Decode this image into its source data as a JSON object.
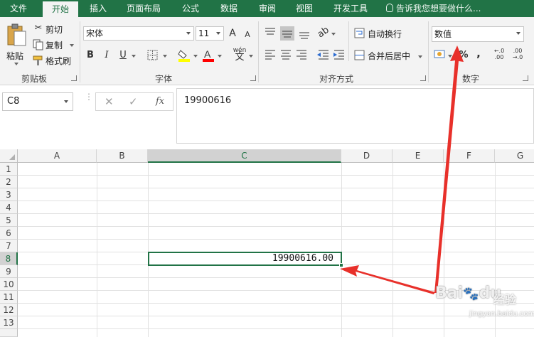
{
  "tabs": [
    "文件",
    "开始",
    "插入",
    "页面布局",
    "公式",
    "数据",
    "审阅",
    "视图",
    "开发工具"
  ],
  "tell_me": "告诉我您想要做什么...",
  "clipboard": {
    "paste": "粘贴",
    "cut": "剪切",
    "copy": "复制",
    "format_painter": "格式刷",
    "group": "剪贴板"
  },
  "font": {
    "name": "宋体",
    "size": "11",
    "bold": "B",
    "italic": "I",
    "underline": "U",
    "phonetic": "wén",
    "grow": "A",
    "shrink": "A",
    "group": "字体",
    "fill_color": "#ffff00",
    "font_color": "#ff0000"
  },
  "alignment": {
    "wrap": "自动换行",
    "merge": "合并后居中",
    "group": "对齐方式"
  },
  "number": {
    "format": "数值",
    "percent": "%",
    "comma": ",",
    "inc_decimal": "←.0\n.00",
    "dec_decimal": ".00\n→.0",
    "group": "数字"
  },
  "namebox": "C8",
  "formula_buttons": {
    "cancel": "✕",
    "enter": "✓",
    "fx": "fx"
  },
  "formula": "19900616",
  "columns": [
    "A",
    "B",
    "C",
    "D",
    "E",
    "F",
    "G"
  ],
  "rows": [
    "1",
    "2",
    "3",
    "4",
    "5",
    "6",
    "7",
    "8",
    "9",
    "10",
    "11",
    "12",
    "13"
  ],
  "cell_c8": "19900616.00",
  "watermark": {
    "main": "Bai",
    "du": "du",
    "jy": "经验",
    "url": "jingyan.baidu.com"
  },
  "colors": {
    "excel_green": "#217346",
    "arrow_red": "#e8302a"
  }
}
